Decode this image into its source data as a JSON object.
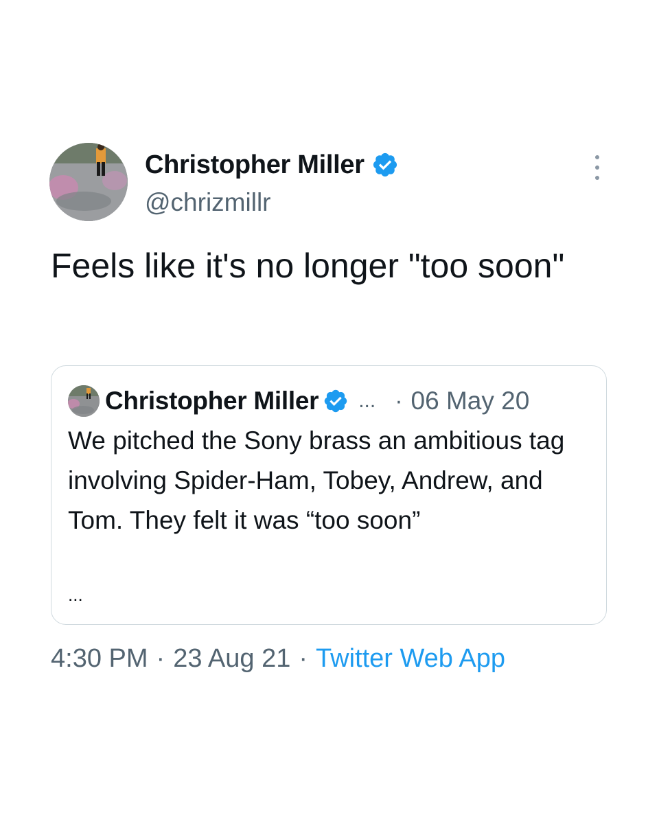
{
  "tweet": {
    "author": {
      "display_name": "Christopher Miller",
      "handle": "@chrizmillr",
      "verified": true
    },
    "text": "Feels like it's no longer \"too soon\"",
    "quoted_tweet": {
      "author_display_name": "Christopher Miller",
      "verified": true,
      "truncated_handle": "...",
      "separator": "·",
      "date": "06 May 20",
      "text": "We pitched the Sony brass an ambitious tag involving Spider-Ham, Tobey, Andrew, and Tom. They felt it was “too soon”",
      "more": "..."
    },
    "meta": {
      "time": "4:30 PM",
      "separator": "·",
      "date": "23 Aug 21",
      "source": "Twitter Web App"
    }
  },
  "colors": {
    "text_primary": "#0f1419",
    "text_secondary": "#536471",
    "accent": "#1d9bf0",
    "border": "#cfd9de"
  },
  "icons": {
    "verified": "verified-badge-icon",
    "more": "more-vertical-icon"
  }
}
